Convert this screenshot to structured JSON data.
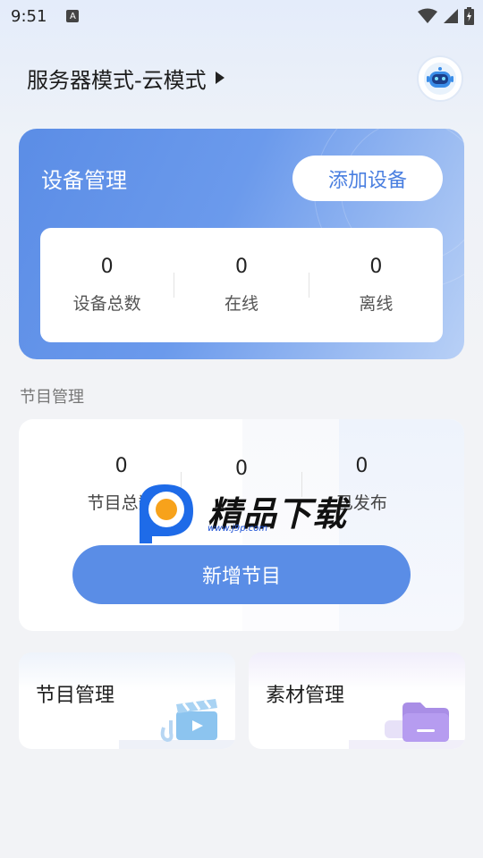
{
  "status_bar": {
    "time": "9:51",
    "notification_icon": "A"
  },
  "header": {
    "mode_title": "服务器模式-云模式",
    "avatar_icon": "robot-icon"
  },
  "device_card": {
    "title": "设备管理",
    "add_button": "添加设备",
    "stats": [
      {
        "value": "0",
        "label": "设备总数"
      },
      {
        "value": "0",
        "label": "在线"
      },
      {
        "value": "0",
        "label": "离线"
      }
    ]
  },
  "program_section": {
    "label": "节目管理",
    "stats": [
      {
        "value": "0",
        "label": "节目总数"
      },
      {
        "value": "0",
        "label": ""
      },
      {
        "value": "0",
        "label": "已发布"
      }
    ],
    "add_button": "新增节目"
  },
  "watermark": {
    "text": "精品下载",
    "url": "www.j9p.com"
  },
  "tiles": [
    {
      "label": "节目管理",
      "icon": "clapperboard-icon"
    },
    {
      "label": "素材管理",
      "icon": "folder-icon"
    }
  ],
  "colors": {
    "primary": "#5a8de6",
    "card_gradient_end": "#b8d0f6",
    "background": "#f2f3f6"
  }
}
